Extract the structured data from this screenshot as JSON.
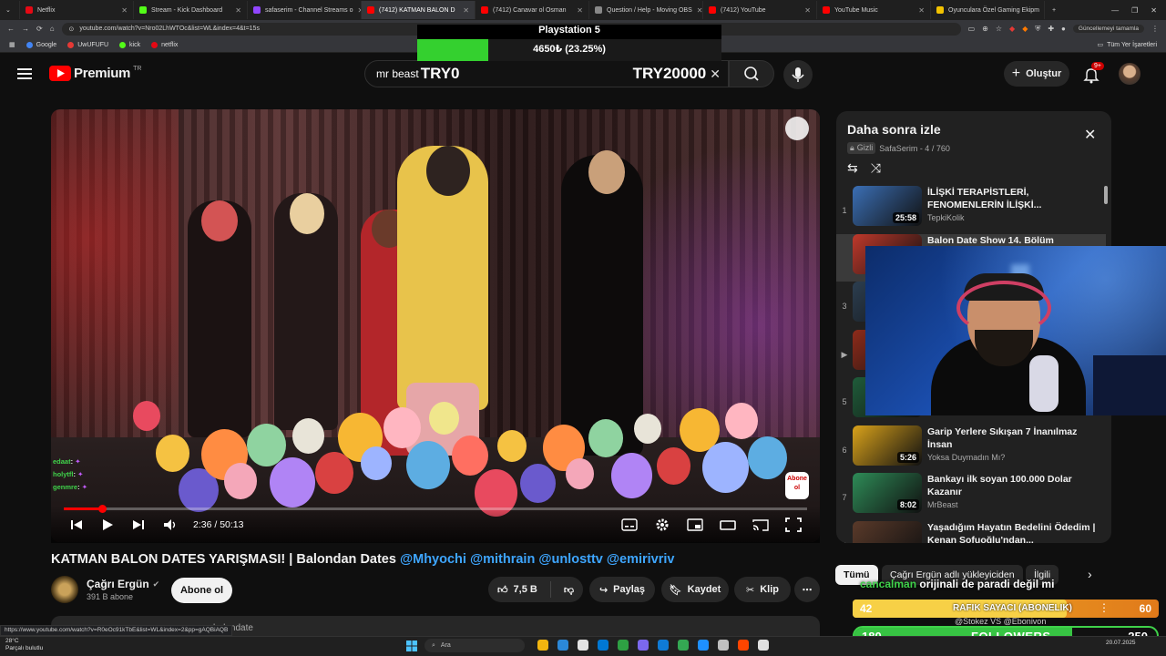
{
  "browser": {
    "tabs": [
      {
        "label": "Netflix",
        "color": "#e50914"
      },
      {
        "label": "Stream - Kick Dashboard",
        "color": "#53fc18"
      },
      {
        "label": "safaserim - Channel Streams o",
        "color": "#9146ff"
      },
      {
        "label": "(7412) KATMAN BALON D",
        "color": "#ff0000"
      },
      {
        "label": "(7412) Canavar ol Osman",
        "color": "#ff0000"
      },
      {
        "label": "Question / Help - Moving OBS",
        "color": "#888888"
      },
      {
        "label": "(7412) YouTube",
        "color": "#ff0000"
      },
      {
        "label": "YouTube Music",
        "color": "#ff0000"
      },
      {
        "label": "Oyunculara Özel Gaming Ekipm",
        "color": "#f2c200"
      }
    ],
    "url": "youtube.com/watch?v=Nro02LhWTOc&list=WL&index=4&t=15s",
    "update_label": "Güncellemeyi tamamla",
    "bookmarks": [
      {
        "label": "Google",
        "color": "#4285f4"
      },
      {
        "label": "UwUFUFU",
        "color": "#e53935"
      },
      {
        "label": "kick",
        "color": "#53fc18"
      },
      {
        "label": "netflix",
        "color": "#e50914"
      }
    ],
    "all_bookmarks": "Tüm Yer İşaretleri"
  },
  "overlay": {
    "goal_title": "Playstation 5",
    "goal_progress": "4650₺ (23.25%)",
    "goal_fraction": 0.2325,
    "try_left": "TRY0",
    "try_right": "TRY20000"
  },
  "youtube": {
    "logo": "Premium",
    "region": "TR",
    "search_value": "mr beast",
    "create_label": "Oluştur",
    "notif_count": "9+"
  },
  "video": {
    "time": "2:36 / 50:13",
    "progress_fraction": 0.052,
    "watermark": "Abone ol",
    "chat": [
      {
        "user": "edaat",
        "color": "#3fd24a"
      },
      {
        "user": "holytfl",
        "color": "#3fd24a"
      },
      {
        "user": "genmre",
        "color": "#3fd24a"
      }
    ]
  },
  "below": {
    "title": "KATMAN BALON DATES YARIŞMASI! | Balondan Dates",
    "mentions": "@Mhyochi @mithrain @unlosttv @emirivriv",
    "channel": "Çağrı Ergün",
    "subs": "391 B abone",
    "subscribe": "Abone ol",
    "likes": "7,5 B",
    "share": "Paylaş",
    "save": "Kaydet",
    "clip": "Klip",
    "desc_tail": "balondate",
    "status_url": "https://www.youtube.com/watch?v=R0eOc91kTbE&list=WL&index=2&pp=gAQBiAQB"
  },
  "playlist": {
    "title": "Daha sonra izle",
    "privacy": "Gizli",
    "owner_count": "SafaSerim - 4 / 760",
    "items": [
      {
        "num": "1",
        "title": "İLİŞKİ TERAPİSTLERİ, FENOMENLERİN İLİŞKİ...",
        "channel": "TepkiKolik",
        "dur": "25:58",
        "color": "#3b6fb5"
      },
      {
        "num": "",
        "title": "Balon Date Show 14. Bölüm",
        "channel": "",
        "dur": "",
        "color": "#c0392b"
      },
      {
        "num": "3",
        "title": "",
        "channel": "",
        "dur": "",
        "color": "#2c3e50"
      },
      {
        "num": "▶",
        "title": "",
        "channel": "",
        "dur": "",
        "color": "#8e2b1a"
      },
      {
        "num": "5",
        "title": "",
        "channel": "",
        "dur": "",
        "color": "#1f5c3a"
      },
      {
        "num": "6",
        "title": "Garip Yerlere Sıkışan 7 İnanılmaz İnsan",
        "channel": "Yoksa Duymadın Mı?",
        "dur": "5:26",
        "color": "#d9a21b"
      },
      {
        "num": "7",
        "title": "Bankayı ilk soyan 100.000 Dolar Kazanır",
        "channel": "MrBeast",
        "dur": "8:02",
        "color": "#2e8b57"
      },
      {
        "num": "8",
        "title": "Yaşadığım Hayatın Bedelini Ödedim | Kenan Sofuoğlu'ndan...",
        "channel": "",
        "dur": "",
        "color": "#5a3a2a"
      }
    ]
  },
  "chips": {
    "all": "Tümü",
    "uploader": "Çağrı Ergün adlı yükleyiciden",
    "related": "İlgili"
  },
  "alerts": {
    "chat_user": "cancalman",
    "chat_msg": "orijinali de paradi değil mi",
    "rafik_left": "42",
    "rafik_label": "RAFIK SAYACI (ABONELIK)",
    "rafik_right": "60",
    "rafik_fraction": 0.7,
    "rafik_sub": "@Stokez VS @Ebonivon",
    "followers_left": "180",
    "followers_label": "FOLLOWERS",
    "followers_right": "250",
    "followers_fraction": 0.72
  },
  "taskbar": {
    "weather_temp": "28°C",
    "weather_desc": "Parçalı bulutlu",
    "search": "Ara",
    "date": "20.07.2025"
  }
}
